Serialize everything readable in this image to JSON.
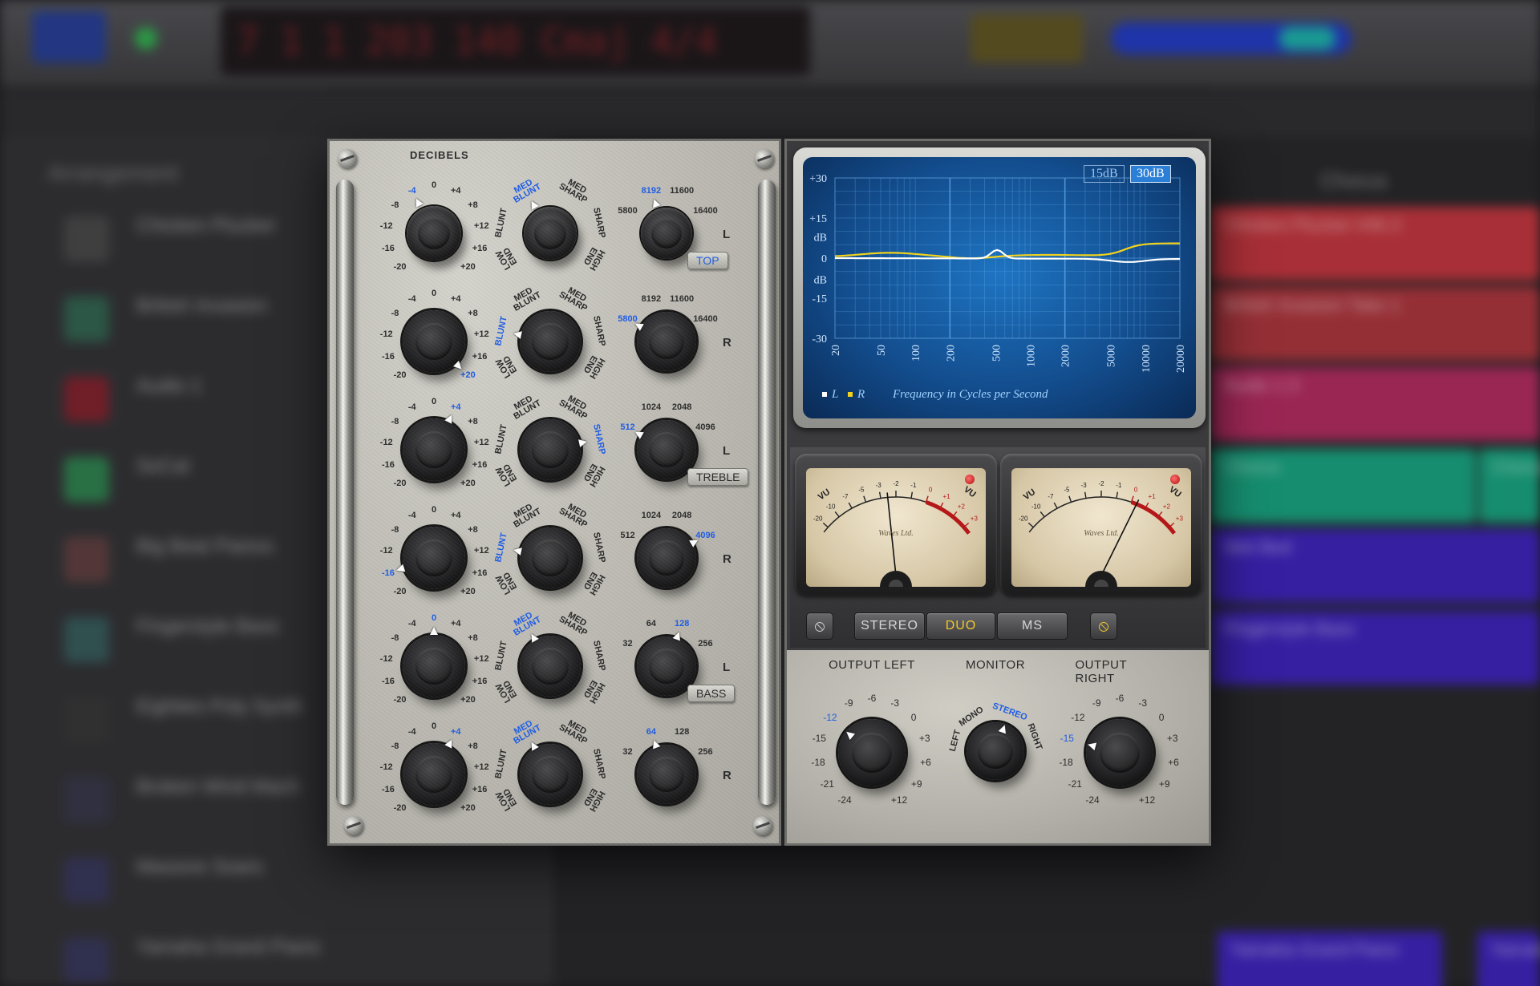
{
  "daw": {
    "lcd_values": [
      "7",
      "1",
      "1",
      "203",
      "140",
      "Cmaj",
      "4/4"
    ],
    "arrangement_label": "Arrangement",
    "chorus_label": "Chorus",
    "tracks": [
      "Chicken Plucker",
      "British Invasion",
      "Audio 1",
      "SoCal",
      "Big Beat Pianos",
      "Fingerstyle Bass",
      "Eighties Poly Synth",
      "Broken Wind Mach",
      "Massive Soars",
      "Yamaha Grand Piano"
    ],
    "regions": [
      "Chicken Plucker #46.3",
      "British Invasion Take 1",
      "Audio 1.3",
      "Chorus",
      "Chorus",
      "Wet Bed",
      "Fingerstyle Bass",
      "Yamaha Grand Piano",
      "Yamaha"
    ]
  },
  "eq": {
    "decibels_title": "DECIBELS",
    "gain_scale": [
      "-20",
      "-16",
      "-12",
      "-8",
      "-4",
      "0",
      "+4",
      "+8",
      "+12",
      "+16",
      "+20"
    ],
    "shape_scale": [
      "LOW END",
      "BLUNT",
      "MED BLUNT",
      "MED SHARP",
      "SHARP",
      "HIGH END"
    ],
    "bands": [
      {
        "gain_sel": "-4",
        "shape_sel": "MED BLUNT",
        "freqs": [
          "5800",
          "8192",
          "11600",
          "16400"
        ],
        "freq_sel": "8192",
        "channel": "L"
      },
      {
        "gain_sel": "+20",
        "shape_sel": "BLUNT",
        "freqs": [
          "5800",
          "8192",
          "11600",
          "16400"
        ],
        "freq_sel": "5800",
        "channel": "R"
      },
      {
        "gain_sel": "+4",
        "shape_sel": "SHARP",
        "freqs": [
          "512",
          "1024",
          "2048",
          "4096"
        ],
        "freq_sel": "512",
        "channel": "L"
      },
      {
        "gain_sel": "-16",
        "shape_sel": "BLUNT",
        "freqs": [
          "512",
          "1024",
          "2048",
          "4096"
        ],
        "freq_sel": "4096",
        "channel": "R"
      },
      {
        "gain_sel": "0",
        "shape_sel": "MED BLUNT",
        "freqs": [
          "32",
          "64",
          "128",
          "256"
        ],
        "freq_sel": "128",
        "channel": "L"
      },
      {
        "gain_sel": "+4",
        "shape_sel": "MED BLUNT",
        "freqs": [
          "32",
          "64",
          "128",
          "256"
        ],
        "freq_sel": "64",
        "channel": "R"
      }
    ],
    "section_tags": [
      "TOP",
      "TREBLE",
      "BASS"
    ],
    "active_tag": "TOP"
  },
  "scope": {
    "range_buttons": [
      "15dB",
      "30dB"
    ],
    "active_range": "30dB",
    "y_labels": [
      "+30",
      "+15",
      "dB",
      "0",
      "dB",
      "-15",
      "-30"
    ],
    "x_labels": [
      "20",
      "50",
      "100",
      "200",
      "500",
      "1000",
      "2000",
      "5000",
      "10000",
      "20000"
    ],
    "legend_l": "L",
    "legend_r": "R",
    "caption": "Frequency in Cycles per Second",
    "colors": {
      "left_curve": "#ffffff",
      "right_curve": "#f2d21b"
    }
  },
  "vu": {
    "scale": [
      "-20",
      "-10",
      "-7",
      "-5",
      "-3",
      "-2",
      "-1",
      "0",
      "+1",
      "+2",
      "+3"
    ],
    "label": "VU",
    "brand": "Waves Ltd.",
    "left_level": 0.45,
    "right_level": 0.72
  },
  "modes": {
    "buttons": [
      "STEREO",
      "DUO",
      "MS"
    ],
    "active": "DUO"
  },
  "output": {
    "left_title": "OUTPUT LEFT",
    "monitor_title": "MONITOR",
    "right_title": "OUTPUT RIGHT",
    "out_scale": [
      "-24",
      "-21",
      "-18",
      "-15",
      "-12",
      "-9",
      "-6",
      "-3",
      "0",
      "+3",
      "+6",
      "+9",
      "+12"
    ],
    "left_sel": "-12",
    "right_sel": "-15",
    "monitor_scale": [
      "LEFT",
      "MONO",
      "STEREO",
      "RIGHT"
    ],
    "monitor_sel": "STEREO"
  }
}
